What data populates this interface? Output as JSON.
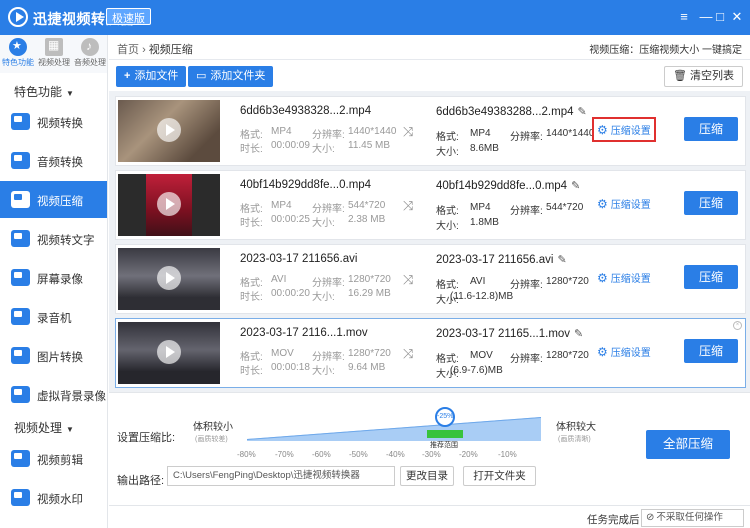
{
  "app": {
    "title": "迅捷视频转换器",
    "badge": "极速版"
  },
  "window_controls": [
    "≡",
    "—",
    "□",
    "✕"
  ],
  "topbar": [
    {
      "label": "特色功能",
      "icon": "star-icon"
    },
    {
      "label": "视频处理",
      "icon": "film-icon"
    },
    {
      "label": "音频处理",
      "icon": "music-note-icon"
    }
  ],
  "sidebar": {
    "section1": "特色功能",
    "section2": "视频处理",
    "caret": "▼",
    "items1": [
      "视频转换",
      "音频转换",
      "视频压缩",
      "视频转文字",
      "屏幕录像",
      "录音机",
      "图片转换",
      "虚拟背景录像"
    ],
    "items2": [
      "视频剪辑",
      "视频水印"
    ]
  },
  "breadcrumb": {
    "home": "首页",
    "sep": "›",
    "current": "视频压缩"
  },
  "hint": "视频压缩：压缩视频大小 一键搞定",
  "toolbar": {
    "add_file": "添加文件",
    "add_folder": "添加文件夹",
    "clear": "清空列表",
    "plus": "+"
  },
  "labels": {
    "format": "格式:",
    "resolution": "分辨率:",
    "duration": "时长:",
    "size": "大小:",
    "compress_settings": "压缩设置",
    "compress": "压缩",
    "pencil": "✎",
    "shuffle": "⤨",
    "gear": "⚙",
    "close": "×"
  },
  "files": [
    {
      "name": "6dd6b3e4938328...2.mp4",
      "format": "MP4",
      "resolution": "1440*1440",
      "duration": "00:00:09",
      "size": "11.45 MB",
      "out_name": "6dd6b3e49383288...2.mp4",
      "out_format": "MP4",
      "out_resolution": "1440*1440",
      "out_size": "8.6MB"
    },
    {
      "name": "40bf14b929dd8fe...0.mp4",
      "format": "MP4",
      "resolution": "544*720",
      "duration": "00:00:25",
      "size": "2.38 MB",
      "out_name": "40bf14b929dd8fe...0.mp4",
      "out_format": "MP4",
      "out_resolution": "544*720",
      "out_size": "1.8MB"
    },
    {
      "name": "2023-03-17 211656.avi",
      "format": "AVI",
      "resolution": "1280*720",
      "duration": "00:00:20",
      "size": "16.29 MB",
      "out_name": "2023-03-17 211656.avi",
      "out_format": "AVI",
      "out_resolution": "1280*720",
      "out_size": "(11.6-12.8)MB"
    },
    {
      "name": "2023-03-17 2116...1.mov",
      "format": "MOV",
      "resolution": "1280*720",
      "duration": "00:00:18",
      "size": "9.64 MB",
      "out_name": "2023-03-17 21165...1.mov",
      "out_format": "MOV",
      "out_resolution": "1280*720",
      "out_size": "(6.9-7.6)MB"
    }
  ],
  "compression": {
    "label": "设置压缩比:",
    "left_label": "体积较小",
    "left_sub": "(画质较差)",
    "right_label": "体积较大",
    "right_sub": "(画质清晰)",
    "ticks": [
      "-80%",
      "-70%",
      "-60%",
      "-50%",
      "-40%",
      "-30%",
      "-20%",
      "-10%"
    ],
    "current": "-25%",
    "recommended": "推荐范围",
    "all_button": "全部压缩"
  },
  "output": {
    "label": "输出路径:",
    "path": "C:\\Users\\FengPing\\Desktop\\迅捷视频转换器",
    "change_dir": "更改目录",
    "open_folder": "打开文件夹"
  },
  "status": {
    "after_label": "任务完成后",
    "after_value": "不采取任何操作",
    "no_icon": "⊘"
  },
  "colors": {
    "accent": "#2a7ee6",
    "highlight_border": "#e0302f",
    "recommended": "#38c33c"
  }
}
